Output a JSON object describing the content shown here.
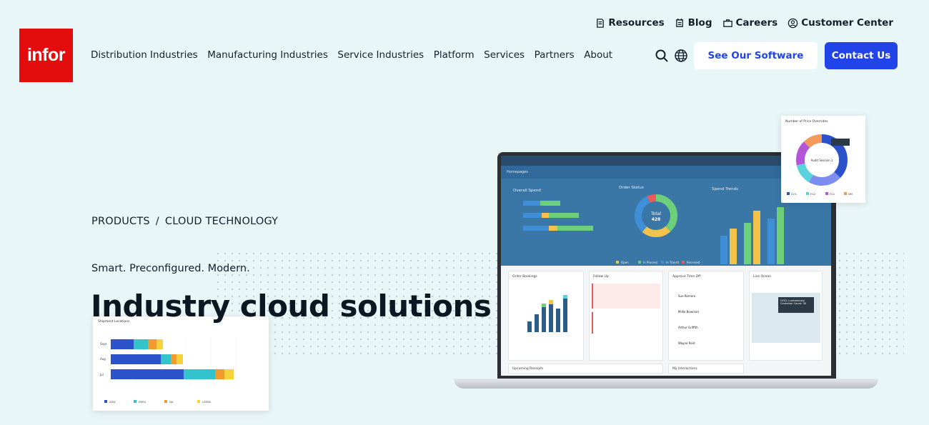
{
  "brand": {
    "logo_text": "infor",
    "logo_color": "#e40d0d"
  },
  "utility_nav": [
    {
      "label": "Resources",
      "icon": "resources-icon"
    },
    {
      "label": "Blog",
      "icon": "blog-icon"
    },
    {
      "label": "Careers",
      "icon": "careers-icon"
    },
    {
      "label": "Customer Center",
      "icon": "user-circle-icon"
    }
  ],
  "main_nav": [
    "Distribution Industries",
    "Manufacturing Industries",
    "Service Industries",
    "Platform",
    "Services",
    "Partners",
    "About"
  ],
  "header_icons": [
    "search-icon",
    "globe-icon"
  ],
  "buttons": {
    "see_software": "See Our Software",
    "contact": "Contact Us"
  },
  "colors": {
    "accent": "#2144e8",
    "background": "#e9f6f8"
  },
  "hero": {
    "breadcrumb": [
      "PRODUCTS",
      "CLOUD TECHNOLOGY"
    ],
    "breadcrumb_separator": "/",
    "tagline": "Smart. Preconfigured. Modern.",
    "headline": "Industry cloud solutions"
  },
  "dashboard": {
    "tab_label": "Homepages",
    "panels": [
      "Overall Spend",
      "Order Status",
      "Spend Trends"
    ],
    "donut_center": [
      "Total",
      "428"
    ],
    "status_legend": [
      "Open",
      "In Process",
      "In Transit",
      "Received"
    ],
    "cards": [
      "Order Bookings",
      "Follow Up",
      "Approve Time Off",
      "Live Ocean"
    ],
    "people": [
      "Sue Romero",
      "Millie Bowman",
      "Arthur Griffith",
      "Wayne Reid"
    ],
    "bottom_strips": [
      "Upcoming Receipts",
      "My Interactions"
    ],
    "map_label": [
      "OOCL Luxembourg",
      "Container Count: 30"
    ]
  },
  "float_donut": {
    "title": "Number of Price Overrides",
    "center": "Audit Session 1",
    "legend": [
      "22%",
      "FG2",
      "FG1",
      "NM"
    ]
  },
  "float_bars": {
    "title": "Shipment Locations",
    "rows": [
      "Sept",
      "Aug",
      "Jul"
    ],
    "legend": [
      "APAC",
      "EMEA",
      "NA",
      "LATAM"
    ]
  }
}
